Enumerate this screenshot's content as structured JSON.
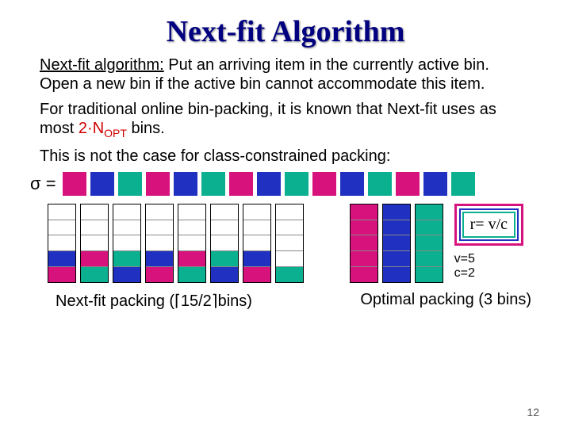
{
  "title": "Next-fit Algorithm",
  "p1_lead": "Next-fit algorithm:",
  "p1_rest": " Put an arriving item in the currently active bin. Open a new bin if the active bin cannot accommodate this item.",
  "p2_a": "For traditional online bin-packing, it is known that Next-fit uses as most ",
  "p2_red": "2·N",
  "p2_sub": "OPT",
  "p2_b": " bins.",
  "p3": "This is not the case for class-constrained packing:",
  "sigma_label": "σ =",
  "sigma_seq": [
    "magenta",
    "blue",
    "teal",
    "magenta",
    "blue",
    "teal",
    "magenta",
    "blue",
    "teal",
    "magenta",
    "blue",
    "teal",
    "magenta",
    "blue",
    "teal"
  ],
  "rbox": "r= v/c",
  "vc": "v=5\nc=2",
  "nf_caption": "Next-fit packing (⌈15/2⌉bins)",
  "opt_caption": "Optimal packing (3 bins)",
  "page": "12",
  "chart_data": {
    "type": "bar",
    "title": "Bin-packing illustration (class-constrained)",
    "bin_capacity": 5,
    "color_classes": 2,
    "nextfit_bins": [
      [
        "magenta",
        "blue",
        "empty",
        "empty",
        "empty"
      ],
      [
        "teal",
        "magenta",
        "empty",
        "empty",
        "empty"
      ],
      [
        "blue",
        "teal",
        "empty",
        "empty",
        "empty"
      ],
      [
        "magenta",
        "blue",
        "empty",
        "empty",
        "empty"
      ],
      [
        "teal",
        "magenta",
        "empty",
        "empty",
        "empty"
      ],
      [
        "blue",
        "teal",
        "empty",
        "empty",
        "empty"
      ],
      [
        "magenta",
        "blue",
        "empty",
        "empty",
        "empty"
      ],
      [
        "teal",
        "empty",
        "empty",
        "empty",
        "empty"
      ]
    ],
    "optimal_bins": [
      [
        "magenta",
        "magenta",
        "magenta",
        "magenta",
        "magenta"
      ],
      [
        "blue",
        "blue",
        "blue",
        "blue",
        "blue"
      ],
      [
        "teal",
        "teal",
        "teal",
        "teal",
        "teal"
      ]
    ],
    "nextfit_bin_count": 8,
    "optimal_bin_count": 3,
    "ratio_formula": "r = v/c",
    "v": 5,
    "c": 2
  }
}
